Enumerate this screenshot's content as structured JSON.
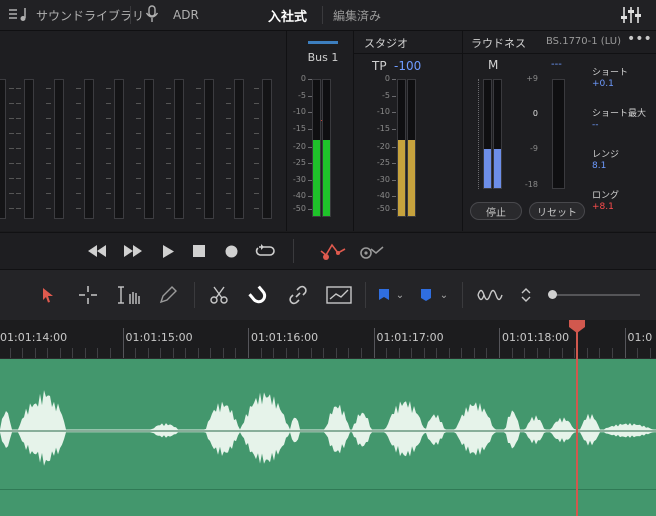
{
  "topbar": {
    "sound_library": "サウンドライブラリ",
    "adr": "ADR",
    "active_tab": "入社式",
    "tab2": "編集済み"
  },
  "bus": {
    "label": "Bus 1"
  },
  "studio": {
    "title": "スタジオ",
    "tp_label": "TP",
    "tp_value": "-100"
  },
  "loudness": {
    "title": "ラウドネス",
    "standard": "BS.1770-1 (LU)",
    "m_label": "M",
    "dashes": "---",
    "short_label": "ショート",
    "short_value": "+0.1",
    "short_max_label": "ショート最大",
    "short_max_value": "--",
    "range_label": "レンジ",
    "range_value": "8.1",
    "long_label": "ロング",
    "long_value": "+8.1",
    "stop": "停止",
    "reset": "リセット",
    "scale": [
      "+9",
      "0",
      "-9",
      "-18"
    ],
    "meter_level": 0.36
  },
  "meter_scale": [
    "0",
    "-5",
    "-10",
    "-15",
    "-20",
    "-25",
    "-30",
    "-40",
    "-50"
  ],
  "bus_meter_levels": [
    0.56,
    0.56
  ],
  "studio_meter_levels": [
    0.56,
    0.56
  ],
  "ruler": {
    "timecodes": [
      "01:01:14:00",
      "01:01:15:00",
      "01:01:16:00",
      "01:01:17:00",
      "01:01:18:00",
      "01:0"
    ]
  },
  "colors": {
    "accent_blue": "#6e9bff",
    "accent_red": "#ff4d4d",
    "meter_green": "#1fc22a",
    "meter_yellow": "#c6a23d",
    "meter_blue": "#6d8ee8",
    "track_green": "#43976d",
    "playhead": "#d1584e"
  }
}
